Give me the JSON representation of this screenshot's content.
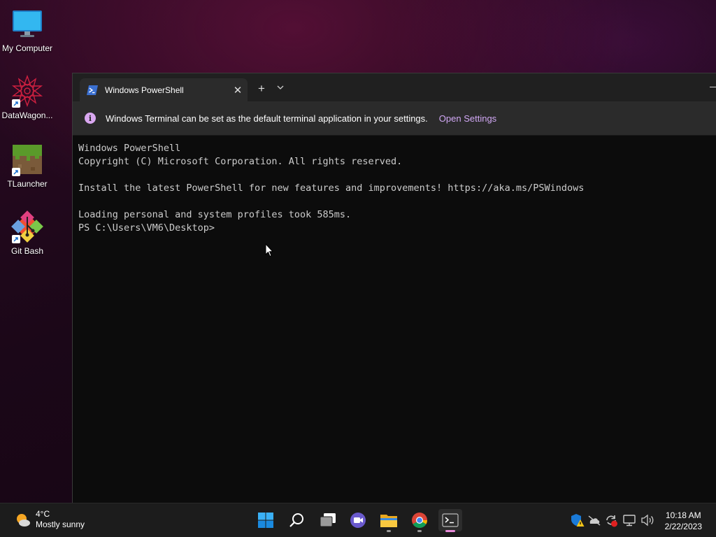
{
  "desktop": {
    "icons": [
      {
        "label": "My Computer",
        "icon": "monitor-icon"
      },
      {
        "label": "DataWagon...",
        "icon": "datawagon-icon"
      },
      {
        "label": "TLauncher",
        "icon": "grass-block-icon"
      },
      {
        "label": "Git Bash",
        "icon": "git-icon"
      }
    ]
  },
  "terminal": {
    "tab_title": "Windows PowerShell",
    "infobar_message": "Windows Terminal can be set as the default terminal application in your settings.",
    "infobar_link": "Open Settings",
    "lines": [
      "Windows PowerShell",
      "Copyright (C) Microsoft Corporation. All rights reserved.",
      "",
      "Install the latest PowerShell for new features and improvements! https://aka.ms/PSWindows",
      "",
      "Loading personal and system profiles took 585ms.",
      "PS C:\\Users\\VM6\\Desktop>"
    ]
  },
  "taskbar": {
    "weather_temp": "4°C",
    "weather_desc": "Mostly sunny",
    "apps": [
      "start-icon",
      "search-icon",
      "task-view-icon",
      "chat-icon",
      "file-explorer-icon",
      "chrome-icon",
      "terminal-icon"
    ],
    "time": "10:18 AM",
    "date": "2/22/2023"
  },
  "colors": {
    "console_bg": "#0c0c0c",
    "console_text": "#cccccc",
    "link": "#d1a8f5",
    "accent_indicator": "#e88ad8"
  }
}
